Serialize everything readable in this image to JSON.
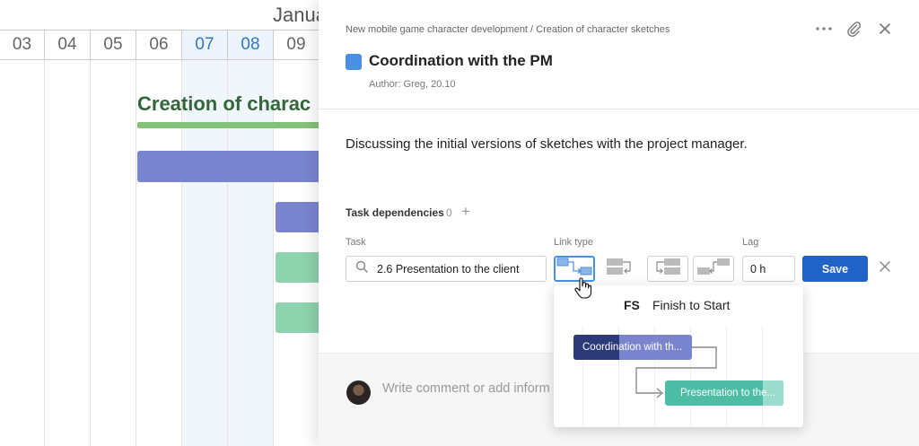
{
  "gantt": {
    "month": "Janua",
    "days": [
      {
        "label": "03",
        "highlight": false
      },
      {
        "label": "04",
        "highlight": false
      },
      {
        "label": "05",
        "highlight": false
      },
      {
        "label": "06",
        "highlight": false
      },
      {
        "label": "07",
        "highlight": true
      },
      {
        "label": "08",
        "highlight": true
      },
      {
        "label": "09",
        "highlight": false
      }
    ],
    "group_title": "Creation of charac",
    "colors": {
      "group_bar": "#86c17a",
      "purple_bar": "#7b85cf",
      "green_bar": "#8ed3ad",
      "title": "#33663a",
      "highlight_day": "#2f76c7"
    }
  },
  "panel": {
    "breadcrumb": "New mobile game character development / Creation of character sketches",
    "more_icon": "more-horizontal-icon",
    "attach_icon": "paperclip-icon",
    "close_icon": "close-icon",
    "task_color": "#4a90e2",
    "title": "Coordination with the PM",
    "author": "Author: Greg, 20.10",
    "description": "Discussing the initial versions of sketches with the project manager.",
    "dependencies": {
      "label": "Task dependencies",
      "count": "0",
      "add": "+",
      "task_label": "Task",
      "task_value": "2.6 Presentation to the client",
      "link_type_label": "Link type",
      "link_types": [
        "finish-to-start",
        "finish-to-finish",
        "start-to-start",
        "start-to-finish"
      ],
      "active_link_type": "finish-to-start",
      "lag_label": "Lag",
      "lag_value": "0 h",
      "save": "Save"
    },
    "comment_placeholder": "Write comment or add inform"
  },
  "popup": {
    "code": "FS",
    "name": "Finish to Start",
    "from_task": "Coordination with th...",
    "to_task": "Presentation to the...",
    "colors": {
      "from_dark": "#2d3a7a",
      "from_light": "#7b85cf",
      "to_main": "#4dbda6",
      "to_light": "#9bdccd"
    }
  }
}
